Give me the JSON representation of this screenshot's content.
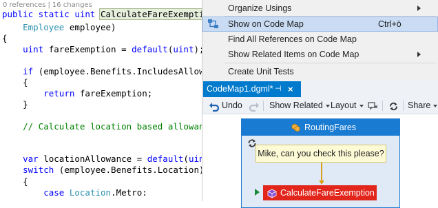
{
  "editor": {
    "codelens": {
      "references": "0 references",
      "changes": "16 changes"
    },
    "lines": {
      "l1_kw": "public static uint ",
      "l1_fn": "CalculateFareExemption",
      "l1_paren": "(",
      "l2_type": "Employee",
      "l2_rest": " employee)",
      "l3": "{",
      "l4_type": "uint",
      "l4_mid": " fareExemption = ",
      "l4_kw": "default",
      "l4_open": "(",
      "l4_kw2": "uint",
      "l4_close": ");",
      "l6_kw": "if",
      "l6_rest": " (employee.Benefits.IncludesAllowan",
      "l7": "{",
      "l8_kw": "return",
      "l8_rest": " fareExemption;",
      "l9": "}",
      "l11_comment": "// Calculate location based allowance",
      "l13_type": "var",
      "l13_mid": " locationAllowance = ",
      "l13_kw": "default",
      "l13_open": "(",
      "l13_kw2": "uint",
      "l13_close": ");",
      "l14_kw": "switch",
      "l14_rest": " (employee.Benefits.Location)",
      "l15": "{",
      "l16_kw": "case",
      "l16_sp": " ",
      "l16_type": "Location",
      "l16_rest": ".Metro:"
    }
  },
  "context_menu": {
    "items": [
      {
        "label": "Organize Usings",
        "shortcut": "",
        "submenu": true,
        "highlighted": false
      },
      {
        "label": "Show on Code Map",
        "shortcut": "Ctrl+ö",
        "submenu": false,
        "highlighted": true,
        "icon": "show-on-code-map-icon"
      },
      {
        "label": "Find All References on Code Map",
        "shortcut": "",
        "submenu": false,
        "highlighted": false
      },
      {
        "label": "Show Related Items on Code Map",
        "shortcut": "",
        "submenu": true,
        "highlighted": false
      },
      {
        "label": "Create Unit Tests",
        "shortcut": "",
        "submenu": false,
        "highlighted": false
      }
    ]
  },
  "codemap": {
    "tab": {
      "title": "CodeMap1.dgml*",
      "pin": "⊣",
      "close": "×"
    },
    "toolbar": {
      "undo": "Undo",
      "show_related": "Show Related",
      "layout": "Layout",
      "share": "Share"
    },
    "group": {
      "title": "RoutingFares"
    },
    "comment": "Mike, can you check this please?",
    "method_node": "CalculateFareExemption"
  },
  "colors": {
    "accent": "#007acc",
    "group_header": "#1a7bd3",
    "method_node": "#e2261c",
    "comment_bg": "#fdfbd6",
    "menu_highlight": "#c9dcf3",
    "keyword": "#0000ff",
    "type": "#2b91af",
    "comment": "#008000"
  }
}
